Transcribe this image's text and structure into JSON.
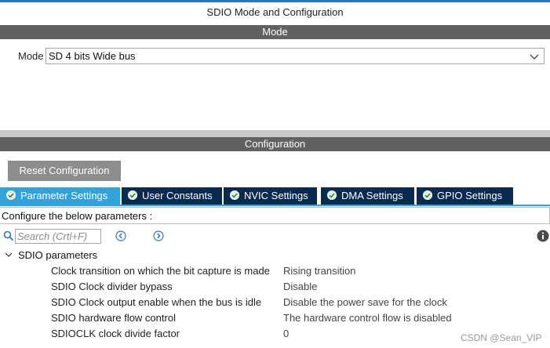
{
  "window": {
    "title": "SDIO Mode and Configuration"
  },
  "mode_section": {
    "header": "Mode",
    "mode_label": "Mode",
    "mode_value": "SD 4 bits Wide bus"
  },
  "config_section": {
    "header": "Configuration",
    "reset_button": "Reset Configuration",
    "tabs": [
      {
        "label": "Parameter Settings",
        "active": true
      },
      {
        "label": "User Constants",
        "active": false
      },
      {
        "label": "NVIC Settings",
        "active": false
      },
      {
        "label": "DMA Settings",
        "active": false
      },
      {
        "label": "GPIO Settings",
        "active": false
      }
    ],
    "instructions": "Configure the below parameters :",
    "search_placeholder": "Search (Crtl+F)",
    "group": {
      "title": "SDIO parameters",
      "params": [
        {
          "name": "Clock transition on which the bit capture is made",
          "value": "Rising transition"
        },
        {
          "name": "SDIO Clock divider bypass",
          "value": "Disable"
        },
        {
          "name": "SDIO Clock output enable when the bus is idle",
          "value": "Disable the power save for the clock"
        },
        {
          "name": "SDIO hardware flow control",
          "value": "The hardware control flow is disabled"
        },
        {
          "name": "SDIOCLK clock divide factor",
          "value": "0"
        }
      ]
    }
  },
  "watermark": "CSDN @Sean_VIP",
  "colors": {
    "section_header_bg": "#5f6163",
    "tab_active": "#32a2d8",
    "tab_inactive": "#0b2a52",
    "reset_button_bg": "#8d8d8d",
    "accent_blue": "#2e75b6"
  },
  "icons": [
    "chevron-down-icon",
    "check-circle-icon",
    "search-icon",
    "arrow-left-circle-icon",
    "arrow-right-circle-icon",
    "info-icon",
    "expand-chevron-icon"
  ]
}
